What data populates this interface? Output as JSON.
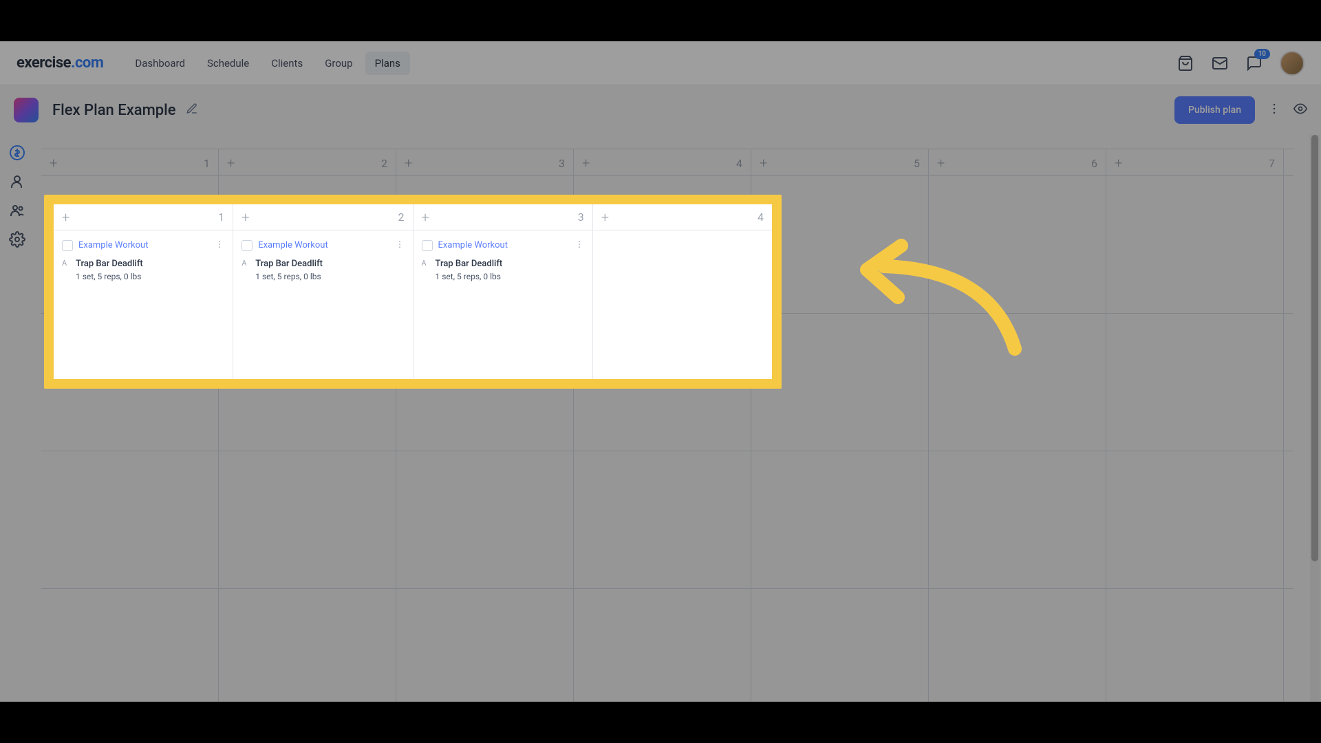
{
  "brand": {
    "part1": "exercise",
    "part2": ".com"
  },
  "nav": {
    "items": [
      {
        "label": "Dashboard"
      },
      {
        "label": "Schedule"
      },
      {
        "label": "Clients"
      },
      {
        "label": "Group"
      },
      {
        "label": "Plans",
        "active": true
      }
    ],
    "badge_count": "10"
  },
  "page": {
    "title": "Flex Plan Example",
    "publish_label": "Publish plan"
  },
  "days": [
    {
      "num": "1",
      "workout": {
        "name": "Example Workout",
        "exercise_letter": "A",
        "exercise_name": "Trap Bar Deadlift",
        "detail": "1 set, 5 reps, 0 lbs"
      }
    },
    {
      "num": "2",
      "workout": {
        "name": "Example Workout",
        "exercise_letter": "A",
        "exercise_name": "Trap Bar Deadlift",
        "detail": "1 set, 5 reps, 0 lbs"
      }
    },
    {
      "num": "3",
      "workout": {
        "name": "Example Workout",
        "exercise_letter": "A",
        "exercise_name": "Trap Bar Deadlift",
        "detail": "1 set, 5 reps, 0 lbs"
      }
    },
    {
      "num": "4"
    },
    {
      "num": "5"
    },
    {
      "num": "6"
    },
    {
      "num": "7"
    }
  ]
}
